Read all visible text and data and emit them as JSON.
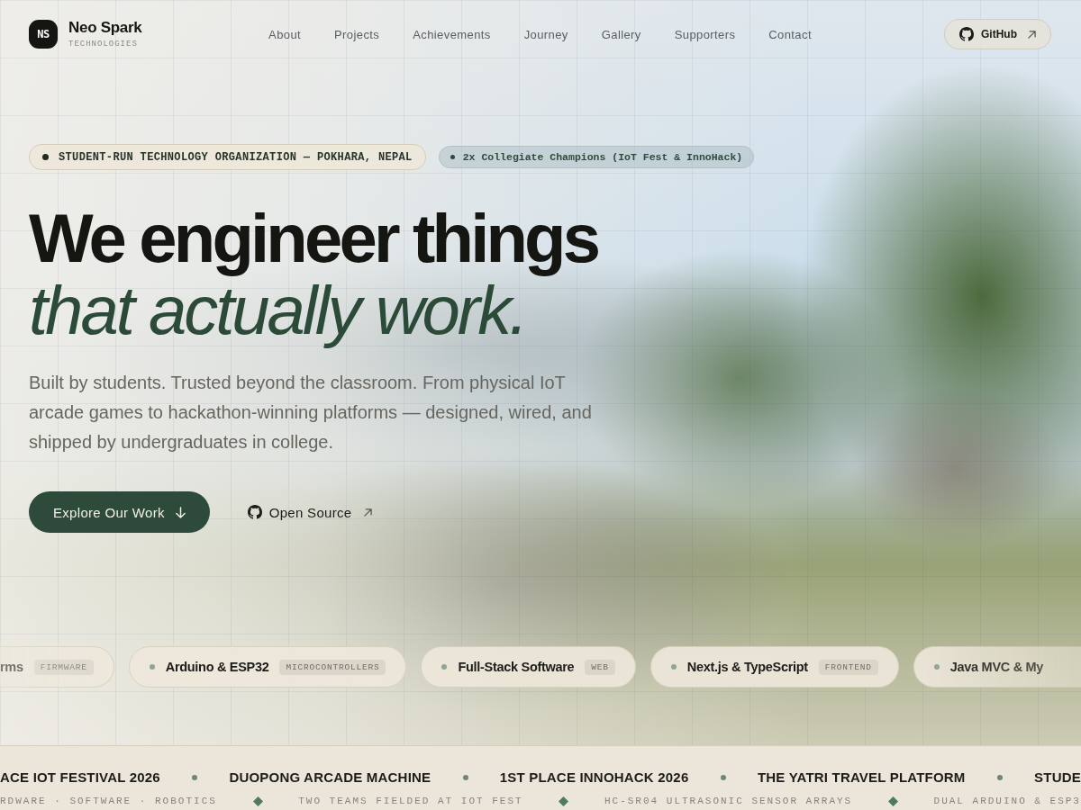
{
  "nav": {
    "logo_mark": "NS",
    "brand": "Neo Spark",
    "tagline": "TECHNOLOGIES",
    "links": [
      "About",
      "Projects",
      "Achievements",
      "Journey",
      "Gallery",
      "Supporters",
      "Contact"
    ],
    "github_button": "GitHub"
  },
  "hero": {
    "badges": [
      {
        "kind": "primary",
        "text": "STUDENT-RUN TECHNOLOGY ORGANIZATION — POKHARA, NEPAL"
      },
      {
        "kind": "secondary",
        "text": "2x Collegiate Champions (IoT Fest & InnoHack)"
      }
    ],
    "headline": "We engineer things",
    "headline_accent": "that actually work.",
    "description": "Built by students. Trusted beyond the classroom. From physical IoT arcade games to hackathon-winning platforms — designed, wired, and shipped by undergraduates in college.",
    "buttons": [
      {
        "kind": "primary",
        "label": "Explore Our Work"
      },
      {
        "kind": "link",
        "label": "Open Source"
      }
    ]
  },
  "skills": [
    {
      "kind": "cut-left",
      "name": "rms",
      "tag": "FIRMWARE"
    },
    {
      "kind": "full",
      "name": "Arduino & ESP32",
      "tag": "MICROCONTROLLERS"
    },
    {
      "kind": "full",
      "name": "Full-Stack Software",
      "tag": "WEB"
    },
    {
      "kind": "full",
      "name": "Next.js & TypeScript",
      "tag": "FRONTEND"
    },
    {
      "kind": "cut-right",
      "name": "Java MVC & My"
    }
  ],
  "ticker": {
    "highlights": [
      "ACE IOT FESTIVAL 2026",
      "DUOPONG ARCADE MACHINE",
      "1ST PLACE INNOHACK 2026",
      "THE YATRI TRAVEL PLATFORM",
      "STUDE"
    ],
    "facts": [
      "RDWARE · SOFTWARE · ROBOTICS",
      "TWO TEAMS FIELDED AT IOT FEST",
      "HC-SR04 ULTRASONIC SENSOR ARRAYS",
      "DUAL ARDUINO & ESP3"
    ]
  }
}
